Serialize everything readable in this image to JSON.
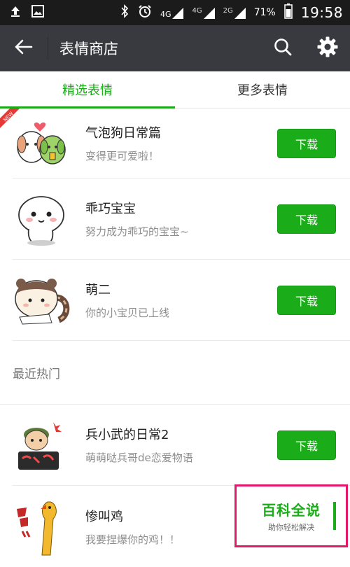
{
  "status_bar": {
    "network_4g": "4G",
    "network_4g_small": "4G",
    "network_2g": "2G",
    "battery": "71%",
    "time": "19:58"
  },
  "title_bar": {
    "title": "表情商店"
  },
  "tabs": [
    {
      "label": "精选表情",
      "active": true
    },
    {
      "label": "更多表情",
      "active": false
    }
  ],
  "featured": [
    {
      "name": "气泡狗日常篇",
      "desc": "变得更可爱啦！",
      "button": "下载",
      "badge": "NEW"
    },
    {
      "name": "乖巧宝宝",
      "desc": "努力成为乖巧的宝宝~",
      "button": "下载"
    },
    {
      "name": "萌二",
      "desc": "你的小宝贝已上线",
      "button": "下载"
    }
  ],
  "recent_hot": {
    "header": "最近热门",
    "items": [
      {
        "name": "兵小武的日常2",
        "desc": "萌萌哒兵哥de恋爱物语",
        "button": "下载"
      },
      {
        "name": "惨叫鸡",
        "desc": "我要捏爆你的鸡！！"
      }
    ]
  },
  "watermark": {
    "title": "百科全说",
    "subtitle": "助你轻松解决"
  },
  "colors": {
    "accent": "#1aad19",
    "titlebar": "#393a3f",
    "statusbar": "#1b1b1b",
    "watermark_border": "#e2186b"
  }
}
